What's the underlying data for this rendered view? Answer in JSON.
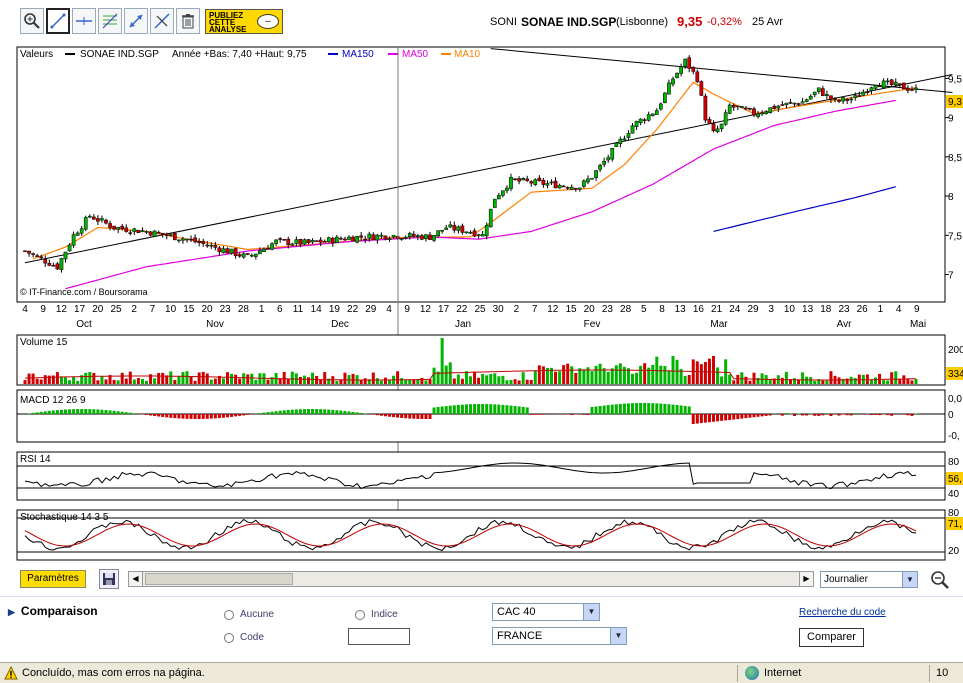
{
  "toolbar": {
    "tools": [
      {
        "name": "zoom-in-tool-button",
        "icon": "zoom-in-icon",
        "active": false
      },
      {
        "name": "draw-line-tool-button",
        "icon": "line-draw-icon",
        "active": true
      },
      {
        "name": "horizontal-line-tool-button",
        "icon": "horizontal-line-icon",
        "active": false
      },
      {
        "name": "fibonacci-tool-button",
        "icon": "fibonacci-icon",
        "active": false
      },
      {
        "name": "move-tool-button",
        "icon": "arrows-icon",
        "active": false
      },
      {
        "name": "erase-line-tool-button",
        "icon": "erase-line-icon",
        "active": false
      },
      {
        "name": "delete-tool-button",
        "icon": "trash-icon",
        "active": false
      }
    ],
    "publiez": {
      "line1": "PUBLIEZ",
      "line2": "CETTE",
      "line3": "ANALYSE",
      "bubble": "..."
    }
  },
  "header": {
    "code": "SONI",
    "name": "SONAE IND.SGP",
    "market": "(Lisbonne)",
    "price": "9,35",
    "change": "-0,32%",
    "date": "25 Avr"
  },
  "legend": {
    "label": "Valeurs",
    "series_name": "SONAE IND.SGP",
    "range_text": "Année +Bas: 7,40 +Haut: 9,75",
    "ma150": "MA150",
    "ma50": "MA50",
    "ma10": "MA10",
    "source": "© IT-Finance.com / Boursorama"
  },
  "colors": {
    "up": "#00b400",
    "down": "#d00000",
    "ma150": "#0000c8",
    "ma50": "#e000e0",
    "ma10": "#ff8000",
    "price_tag": "#ffcc00",
    "accent": "#1a3e8a"
  },
  "price_axis": {
    "ticks": [
      "9,5",
      "9",
      "8,5",
      "8",
      "7,5",
      "7"
    ],
    "current": "9,3"
  },
  "date_axis": {
    "days": [
      "4",
      "9",
      "12",
      "17",
      "20",
      "25",
      "2",
      "7",
      "10",
      "15",
      "20",
      "23",
      "28",
      "1",
      "6",
      "11",
      "14",
      "19",
      "22",
      "29",
      "4",
      "9",
      "12",
      "17",
      "22",
      "25",
      "30",
      "2",
      "7",
      "12",
      "15",
      "20",
      "23",
      "28",
      "5",
      "8",
      "13",
      "16",
      "21",
      "24",
      "29",
      "3",
      "10",
      "13",
      "18",
      "23",
      "26",
      "1",
      "4",
      "9"
    ],
    "months": [
      "Oct",
      "Nov",
      "Dec",
      "Jan",
      "Fev",
      "Mar",
      "Avr",
      "Mai"
    ]
  },
  "panels": {
    "volume": {
      "label": "Volume 15",
      "ticks": [
        "200"
      ],
      "current": "334"
    },
    "macd": {
      "label": "MACD 12 26 9",
      "ticks": [
        "0,0",
        "0",
        "-0,"
      ]
    },
    "rsi": {
      "label": "RSI 14",
      "ticks": [
        "80",
        "60",
        "40"
      ],
      "current": "56,"
    },
    "stoch": {
      "label": "Stochastique 14 3 5",
      "ticks": [
        "80",
        "71,",
        "20"
      ]
    }
  },
  "chart_data": {
    "type": "candlestick",
    "title": "SONAE IND.SGP",
    "price_range": {
      "low": "7,40",
      "high": "9,75"
    },
    "ylim": [
      6.65,
      9.9
    ],
    "series": [
      {
        "name": "SONAE IND.SGP",
        "anchors_close": [
          [
            0,
            7.3
          ],
          [
            8,
            7.1
          ],
          [
            12,
            7.5
          ],
          [
            16,
            7.75
          ],
          [
            22,
            7.6
          ],
          [
            30,
            7.55
          ],
          [
            40,
            7.45
          ],
          [
            50,
            7.3
          ],
          [
            55,
            7.22
          ],
          [
            62,
            7.42
          ],
          [
            70,
            7.4
          ],
          [
            80,
            7.47
          ],
          [
            90,
            7.5
          ],
          [
            100,
            7.48
          ],
          [
            104,
            7.6
          ],
          [
            110,
            7.55
          ],
          [
            113,
            7.5
          ],
          [
            116,
            7.98
          ],
          [
            120,
            8.2
          ],
          [
            130,
            8.15
          ],
          [
            137,
            8.12
          ],
          [
            140,
            8.25
          ],
          [
            144,
            8.5
          ],
          [
            150,
            8.9
          ],
          [
            156,
            9.1
          ],
          [
            160,
            9.5
          ],
          [
            163,
            9.72
          ],
          [
            166,
            9.5
          ],
          [
            168,
            9.0
          ],
          [
            170,
            8.8
          ],
          [
            172,
            8.9
          ],
          [
            174,
            9.15
          ],
          [
            177,
            9.1
          ],
          [
            180,
            9.05
          ],
          [
            186,
            9.15
          ],
          [
            192,
            9.2
          ],
          [
            196,
            9.35
          ],
          [
            200,
            9.2
          ],
          [
            205,
            9.25
          ],
          [
            210,
            9.45
          ],
          [
            216,
            9.4
          ],
          [
            220,
            9.35
          ]
        ]
      },
      {
        "name": "MA10",
        "anchors": [
          [
            2,
            7.2
          ],
          [
            10,
            7.35
          ],
          [
            18,
            7.6
          ],
          [
            30,
            7.55
          ],
          [
            40,
            7.45
          ],
          [
            55,
            7.32
          ],
          [
            70,
            7.38
          ],
          [
            90,
            7.47
          ],
          [
            110,
            7.48
          ],
          [
            116,
            7.7
          ],
          [
            125,
            8.05
          ],
          [
            140,
            8.1
          ],
          [
            148,
            8.4
          ],
          [
            156,
            8.85
          ],
          [
            165,
            9.45
          ],
          [
            170,
            9.3
          ],
          [
            180,
            9.05
          ],
          [
            195,
            9.18
          ],
          [
            210,
            9.3
          ],
          [
            220,
            9.38
          ]
        ]
      },
      {
        "name": "MA50",
        "anchors": [
          [
            10,
            6.82
          ],
          [
            30,
            7.1
          ],
          [
            55,
            7.3
          ],
          [
            80,
            7.42
          ],
          [
            100,
            7.48
          ],
          [
            112,
            7.45
          ],
          [
            125,
            7.55
          ],
          [
            140,
            7.8
          ],
          [
            155,
            8.15
          ],
          [
            170,
            8.6
          ],
          [
            185,
            8.9
          ],
          [
            200,
            9.08
          ],
          [
            215,
            9.22
          ]
        ]
      },
      {
        "name": "MA150",
        "anchors": [
          [
            170,
            7.55
          ],
          [
            190,
            7.8
          ],
          [
            205,
            7.98
          ],
          [
            215,
            8.12
          ]
        ]
      }
    ],
    "trendlines": [
      [
        [
          0,
          7.15
        ],
        [
          229,
          9.55
        ]
      ],
      [
        [
          115,
          9.88
        ],
        [
          229,
          9.32
        ]
      ]
    ],
    "n_candles": 221
  }
}
